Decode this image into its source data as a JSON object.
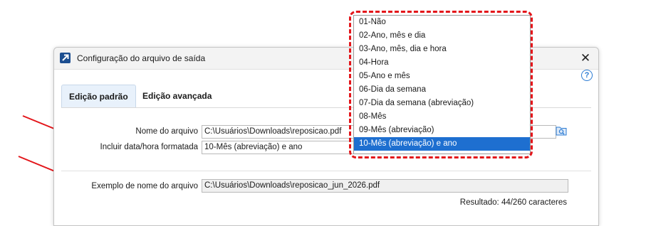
{
  "dialog": {
    "title": "Configuração do arquivo de saída",
    "close_label": "✕",
    "help_label": "?"
  },
  "tabs": [
    {
      "label": "Edição padrão",
      "active": true
    },
    {
      "label": "Edição avançada",
      "active": false
    }
  ],
  "form": {
    "file_name_label": "Nome do arquivo",
    "file_name_value": "C:\\Usuários\\Downloads\\reposicao.pdf",
    "include_date_label": "Incluir data/hora formatada",
    "include_date_value": "10-Mês (abreviação) e ano",
    "example_label": "Exemplo de nome do arquivo",
    "example_value": "C:\\Usuários\\Downloads\\reposicao_jun_2026.pdf",
    "result_text": "Resultado: 44/260 caracteres"
  },
  "dropdown": {
    "options": [
      "01-Não",
      "02-Ano, mês e dia",
      "03-Ano, mês, dia e hora",
      "04-Hora",
      "05-Ano e mês",
      "06-Dia da semana",
      "07-Dia da semana (abreviação)",
      "08-Mês",
      "09-Mês (abreviação)",
      "10-Mês (abreviação) e ano"
    ],
    "selected": "10-Mês (abreviação) e ano"
  },
  "icons": {
    "app": "app-arrow-icon",
    "folder": "folder-search-icon",
    "help": "help-icon",
    "close": "close-icon"
  },
  "colors": {
    "annotation": "#e3151a",
    "selection": "#1e6fd0",
    "accent": "#2b7bd3"
  }
}
